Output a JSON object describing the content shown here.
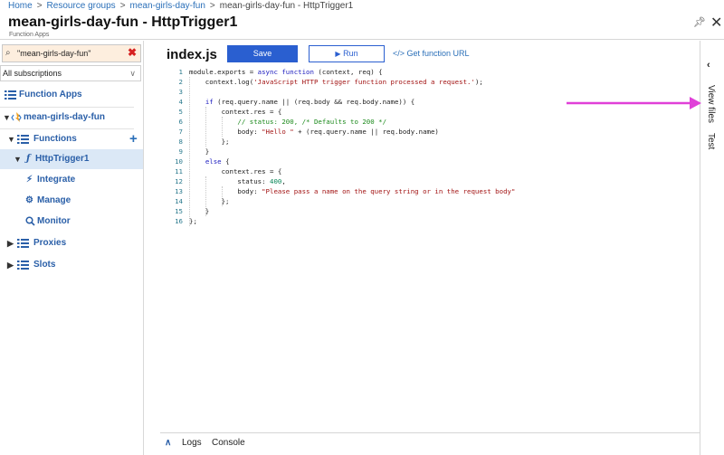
{
  "breadcrumb": [
    "Home",
    "Resource groups",
    "mean-girls-day-fun",
    "mean-girls-day-fun - HttpTrigger1"
  ],
  "title": "mean-girls-day-fun - HttpTrigger1",
  "subtitle": "Function Apps",
  "sidebar": {
    "search_value": "\"mean-girls-day-fun\"",
    "subscriptions": "All subscriptions",
    "items": [
      {
        "label": "Function Apps"
      },
      {
        "label": "mean-girls-day-fun"
      },
      {
        "label": "Functions"
      },
      {
        "label": "HttpTrigger1"
      },
      {
        "label": "Integrate"
      },
      {
        "label": "Manage"
      },
      {
        "label": "Monitor"
      },
      {
        "label": "Proxies"
      },
      {
        "label": "Slots"
      }
    ]
  },
  "editor": {
    "filename": "index.js",
    "save_label": "Save",
    "run_label": "Run",
    "get_url_label": "Get function URL",
    "line_numbers": [
      "1",
      "2",
      "3",
      "4",
      "5",
      "6",
      "7",
      "8",
      "9",
      "10",
      "11",
      "12",
      "13",
      "14",
      "15",
      "16"
    ]
  },
  "right_rail": {
    "view_files": "View files",
    "test": "Test"
  },
  "bottom": {
    "logs": "Logs",
    "console": "Console"
  },
  "colors": {
    "accent": "#2a5fd0",
    "annotation_arrow": "#e040d8",
    "selected_bg": "#dbe8f6"
  }
}
